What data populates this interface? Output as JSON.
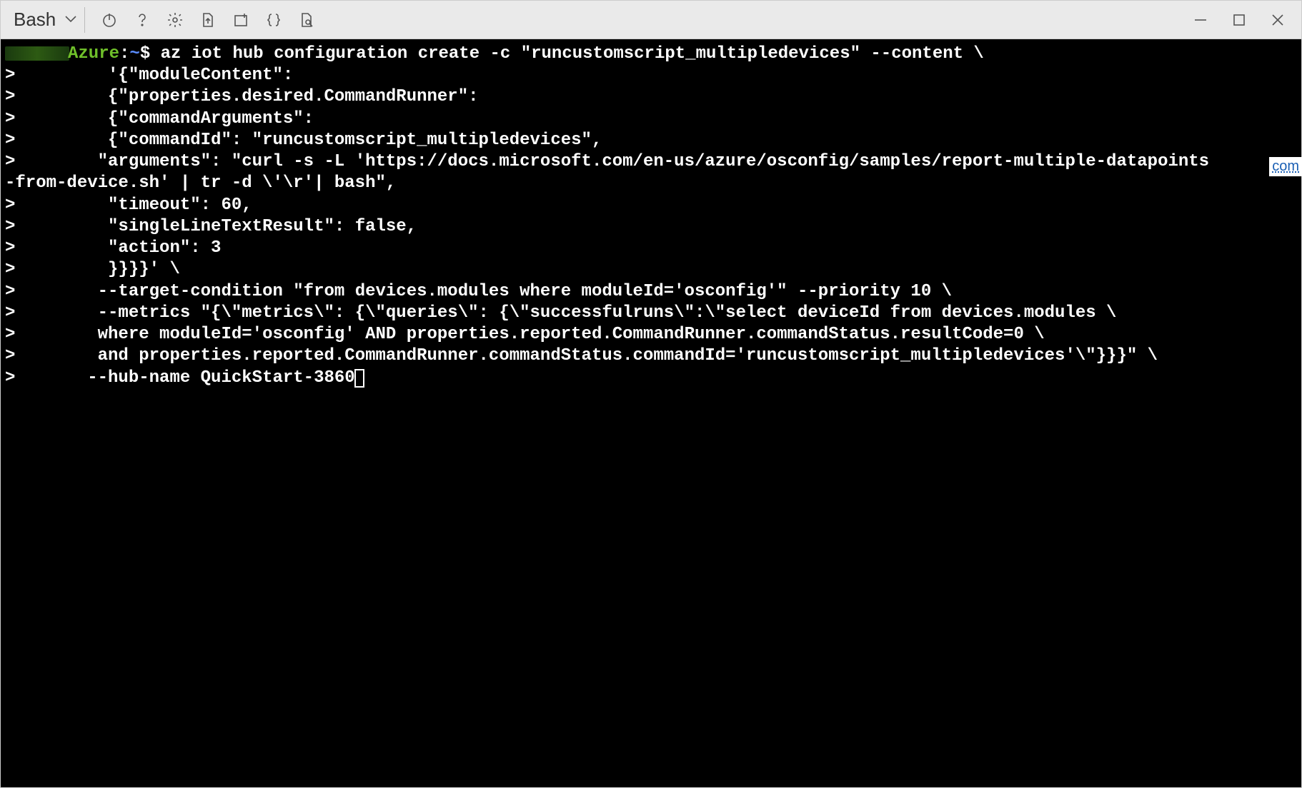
{
  "titlebar": {
    "shell_name": "Bash"
  },
  "prompt": {
    "user": "Azure",
    "sep1": ":",
    "path": "~",
    "dollar": "$"
  },
  "terminal_lines": [
    "az iot hub configuration create -c \"runcustomscript_multipledevices\" --content \\",
    "        '{\"moduleContent\":",
    "        {\"properties.desired.CommandRunner\":",
    "        {\"commandArguments\":",
    "        {\"commandId\": \"runcustomscript_multipledevices\",",
    "       \"arguments\": \"curl -s -L 'https://docs.microsoft.com/en-us/azure/osconfig/samples/report-multiple-datapoints",
    "-from-device.sh' | tr -d \\'\\r'| bash\",",
    "        \"timeout\": 60,",
    "        \"singleLineTextResult\": false,",
    "        \"action\": 3",
    "        }}}}' \\",
    "       --target-condition \"from devices.modules where moduleId='osconfig'\" --priority 10 \\",
    "       --metrics \"{\\\"metrics\\\": {\\\"queries\\\": {\\\"successfulruns\\\":\\\"select deviceId from devices.modules \\",
    "       where moduleId='osconfig' AND properties.reported.CommandRunner.commandStatus.resultCode=0 \\",
    "       and properties.reported.CommandRunner.commandStatus.commandId='runcustomscript_multipledevices'\\\"}}}\" \\",
    "      --hub-name QuickStart-3860"
  ],
  "continuation_prefix": "> ",
  "overflow_hint": "com"
}
